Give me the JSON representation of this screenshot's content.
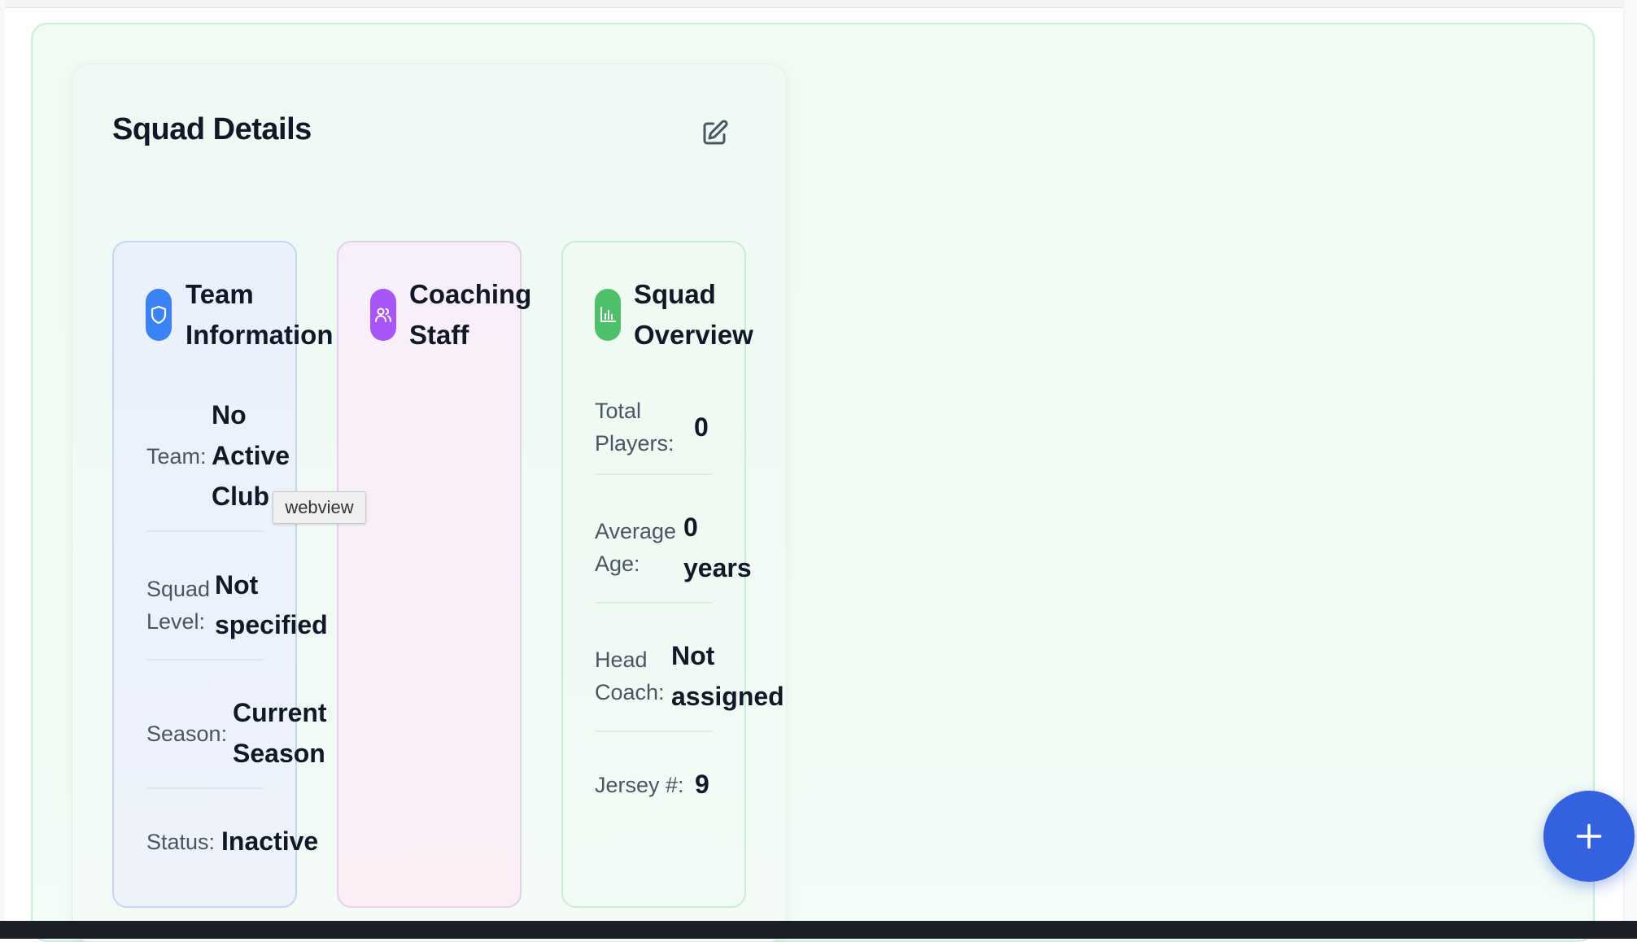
{
  "card": {
    "title": "Squad Details",
    "edit_icon": "edit-square-pencil-icon"
  },
  "team_info": {
    "icon": "shield-icon",
    "accent": "#3b82f6",
    "title_line1": "Team",
    "title_line2": "Information",
    "team_label": "Team:",
    "team_value_line1": "No",
    "team_value_line2": "Active",
    "team_value_line3": "Club",
    "level_label_line1": "Squad",
    "level_label_line2": "Level:",
    "level_value_line1": "Not",
    "level_value_line2": "specified",
    "season_label": "Season:",
    "season_value_line1": "Current",
    "season_value_line2": "Season",
    "status_label": "Status:",
    "status_value": "Inactive"
  },
  "coaching_staff": {
    "icon": "users-icon",
    "accent": "#a855f7",
    "title_line1": "Coaching",
    "title_line2": "Staff"
  },
  "squad_overview": {
    "icon": "bar-chart-icon",
    "accent": "#4fc06a",
    "title_line1": "Squad",
    "title_line2": "Overview",
    "players_label_line1": "Total",
    "players_label_line2": "Players:",
    "players_value": "0",
    "age_label_line1": "Average",
    "age_label_line2": "Age:",
    "age_value_line1": "0",
    "age_value_line2": "years",
    "coach_label_line1": "Head",
    "coach_label_line2": "Coach:",
    "coach_value_line1": "Not",
    "coach_value_line2": "assigned",
    "jersey_label": "Jersey #:",
    "jersey_value": "9"
  },
  "tooltip": {
    "text": "webview"
  },
  "fab": {
    "icon": "plus-icon",
    "color": "#3461e0"
  }
}
